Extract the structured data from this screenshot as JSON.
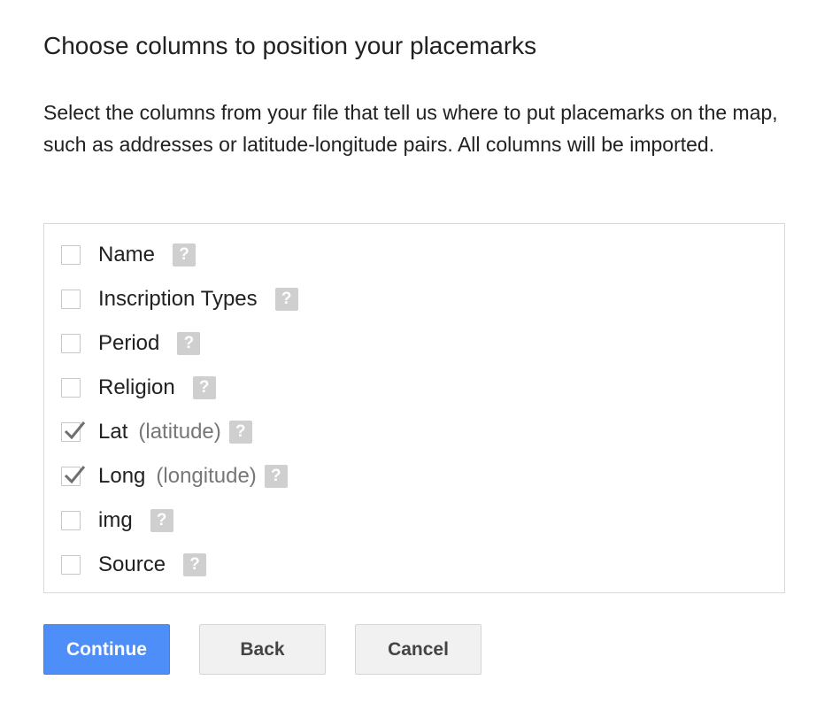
{
  "title": "Choose columns to position your placemarks",
  "description": "Select the columns from your file that tell us where to put placemarks on the map, such as addresses or latitude-longitude pairs. All columns will be imported.",
  "columns": [
    {
      "name": "Name",
      "hint": "",
      "checked": false,
      "help_icon": "help-icon",
      "help_glyph": "?"
    },
    {
      "name": "Inscription Types",
      "hint": "",
      "checked": false,
      "help_icon": "help-icon",
      "help_glyph": "?"
    },
    {
      "name": "Period",
      "hint": "",
      "checked": false,
      "help_icon": "help-icon",
      "help_glyph": "?"
    },
    {
      "name": "Religion",
      "hint": "",
      "checked": false,
      "help_icon": "help-icon",
      "help_glyph": "?"
    },
    {
      "name": "Lat",
      "hint": "(latitude)",
      "checked": true,
      "help_icon": "help-icon",
      "help_glyph": "?"
    },
    {
      "name": "Long",
      "hint": "(longitude)",
      "checked": true,
      "help_icon": "help-icon",
      "help_glyph": "?"
    },
    {
      "name": "img",
      "hint": "",
      "checked": false,
      "help_icon": "help-icon",
      "help_glyph": "?"
    },
    {
      "name": "Source",
      "hint": "",
      "checked": false,
      "help_icon": "help-icon",
      "help_glyph": "?"
    }
  ],
  "buttons": {
    "continue_label": "Continue",
    "back_label": "Back",
    "cancel_label": "Cancel"
  },
  "colors": {
    "primary": "#4d8ef8",
    "checkmark": "#6f6f6f",
    "help_icon_bg": "#cfcfcf"
  }
}
